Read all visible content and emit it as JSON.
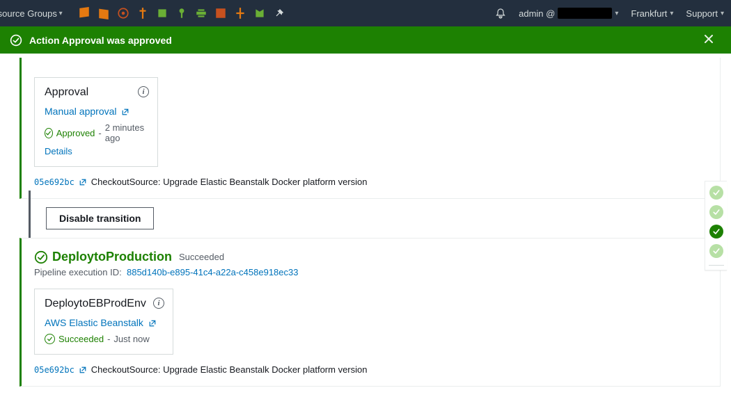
{
  "nav": {
    "resource_label": "Resource Groups",
    "user_prefix": "admin @",
    "region": "Frankfurt",
    "support": "Support"
  },
  "flash": {
    "text": "Action Approval was approved"
  },
  "stage1": {
    "action": {
      "title": "Approval",
      "link": "Manual approval",
      "status": "Approved",
      "time": "2 minutes ago",
      "details": "Details"
    },
    "commit": {
      "hash": "05e692bc",
      "msg": "CheckoutSource: Upgrade Elastic Beanstalk Docker platform version"
    }
  },
  "transition": {
    "button": "Disable transition"
  },
  "stage2": {
    "title": "DeploytoProduction",
    "status": "Succeeded",
    "exec_label": "Pipeline execution ID:",
    "exec_id": "885d140b-e895-41c4-a22a-c458e918ec33",
    "action": {
      "title": "DeploytoEBProdEnv",
      "link": "AWS Elastic Beanstalk",
      "status": "Succeeded",
      "time": "Just now"
    },
    "commit": {
      "hash": "05e692bc",
      "msg": "CheckoutSource: Upgrade Elastic Beanstalk Docker platform version"
    }
  },
  "colors": {
    "green": "#1d8102",
    "link": "#0073bb"
  },
  "icon_colors": [
    "#e47911",
    "#e47911",
    "#c7511f",
    "#e47911",
    "#6aaf35",
    "#6aaf35",
    "#6aaf35",
    "#c7511f",
    "#e47911",
    "#6aaf35",
    "#ffffff"
  ]
}
